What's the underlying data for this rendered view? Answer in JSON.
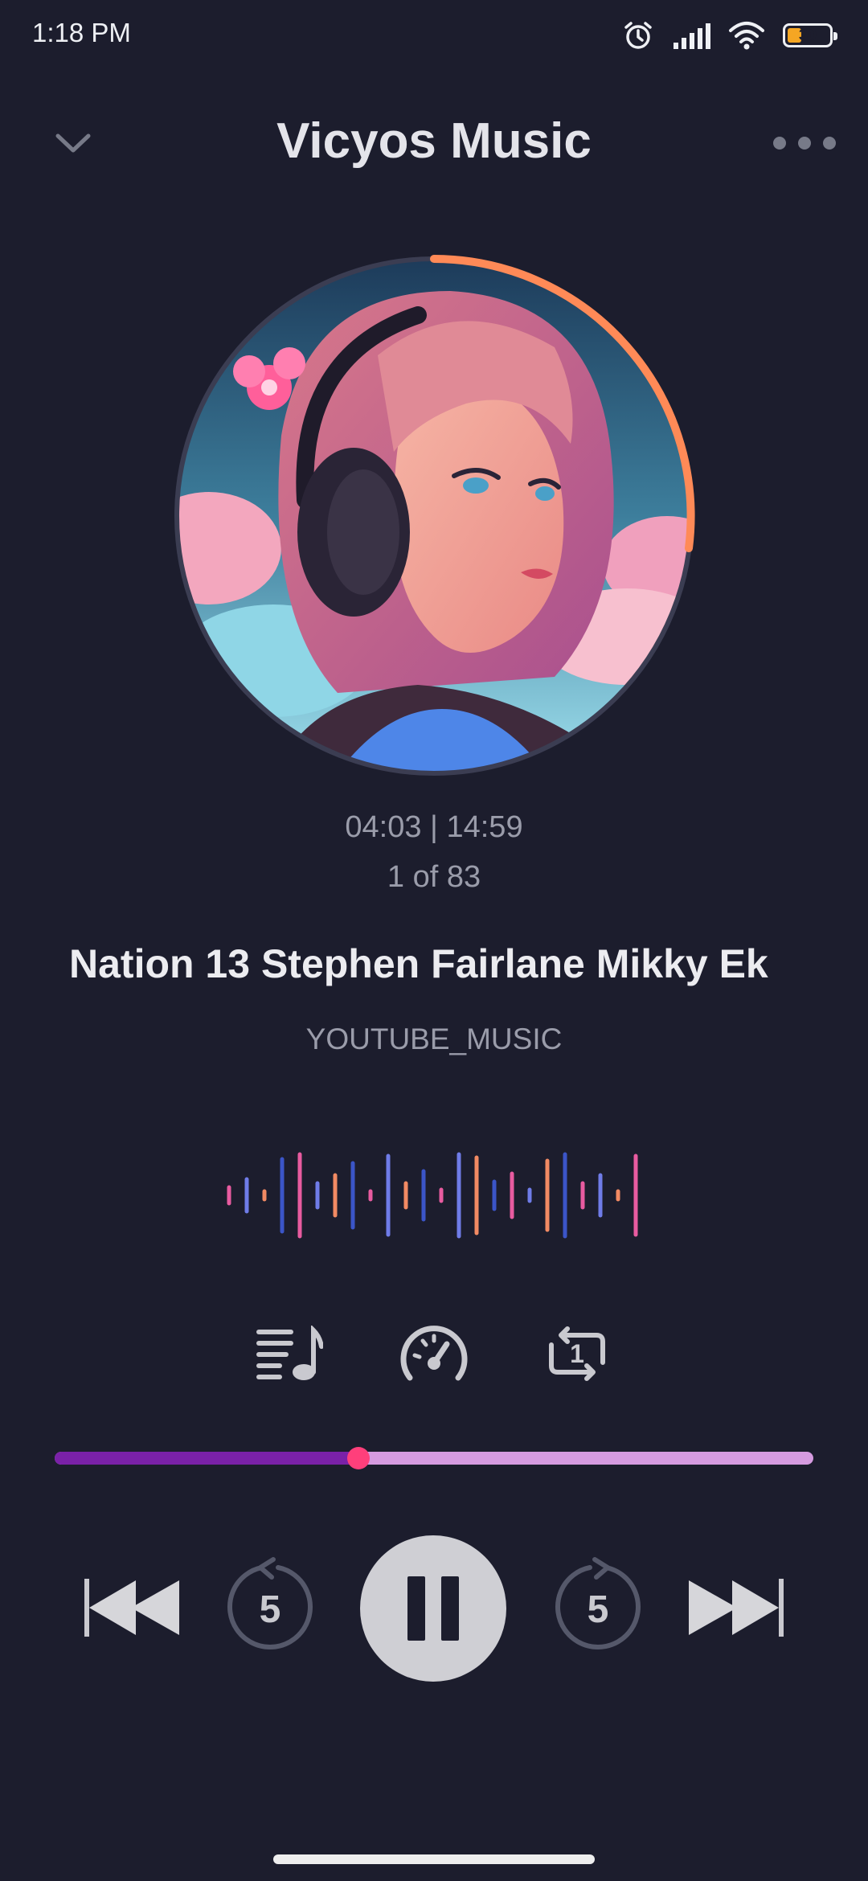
{
  "status_bar": {
    "time": "1:18 PM",
    "battery": "30"
  },
  "header": {
    "title": "Vicyos Music"
  },
  "player": {
    "time": "04:03 | 14:59",
    "index": "1 of 83",
    "title": "Nation 13  Stephen  Fairlane  Mikky Ek",
    "source": "YOUTUBE_MUSIC",
    "progress": 0.4,
    "skip_back_seconds": "5",
    "skip_forward_seconds": "5",
    "repeat_label": "1"
  },
  "colors": {
    "background": "#1c1d2d",
    "ring_accent": "#ff8a57",
    "progress_fill": "#7a21a8",
    "progress_track": "#d69be0",
    "thumb": "#ff3f7b"
  },
  "icons": [
    "chevron-down-icon",
    "more-dots-icon",
    "queue-music-icon",
    "speedometer-icon",
    "repeat-one-icon",
    "skip-previous-icon",
    "replay-5-icon",
    "pause-icon",
    "forward-5-icon",
    "skip-next-icon"
  ]
}
